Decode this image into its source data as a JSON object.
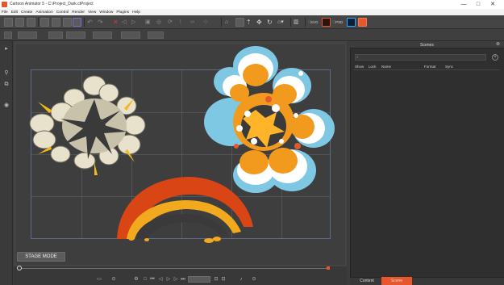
{
  "window": {
    "title": "Cartoon Animator 5 - C:\\Project_Dark.ctProject",
    "controls": [
      "—",
      "□",
      "✕"
    ]
  },
  "menu": [
    "File",
    "Edit",
    "Create",
    "Animation",
    "Control",
    "Render",
    "View",
    "Window",
    "Plugins",
    "Help"
  ],
  "toolbar": {
    "svg_label": "SVG",
    "psd_label": "PSD"
  },
  "stage": {
    "mode_button": "STAGE MODE"
  },
  "scenes_panel": {
    "title": "Scenes",
    "search_icon": "search-icon",
    "columns": [
      "Show",
      "Lock",
      "Name",
      "Format",
      "Sync"
    ]
  },
  "tabs": [
    "Content",
    "Scene"
  ],
  "colors": {
    "accent": "#e8572b",
    "panel_tab_active": "#e8572b",
    "stage_border": "#5e6a8c"
  }
}
